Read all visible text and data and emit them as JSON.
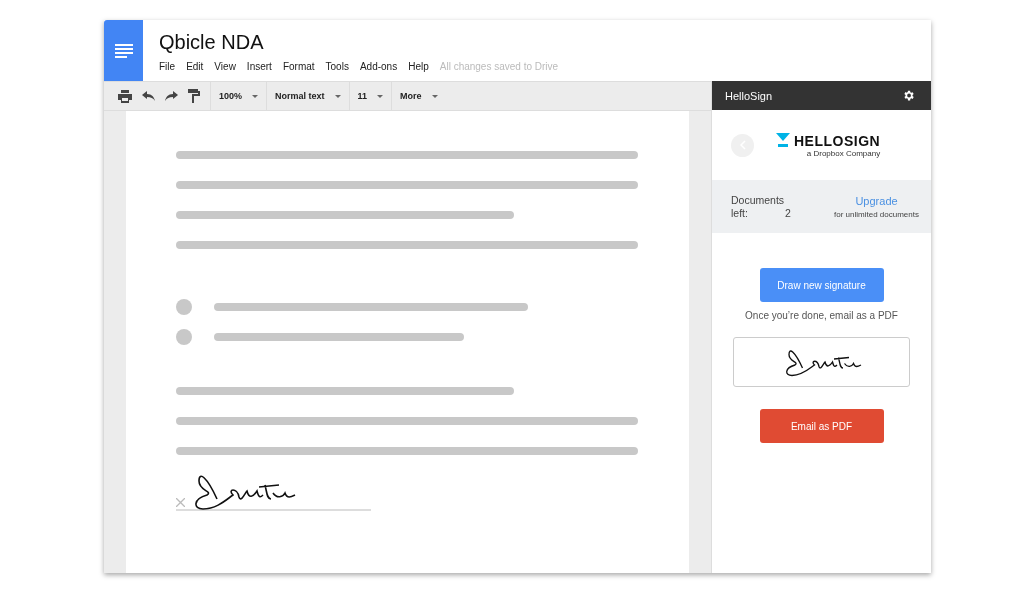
{
  "document": {
    "title": "Qbicle NDA",
    "menu": [
      "File",
      "Edit",
      "View",
      "Insert",
      "Format",
      "Tools",
      "Add-ons",
      "Help"
    ],
    "save_status": "All changes saved to Drive"
  },
  "toolbar": {
    "zoom": "100%",
    "style": "Normal text",
    "size": "11",
    "more": "More"
  },
  "page": {
    "blocks": [
      {
        "kind": "full"
      },
      {
        "kind": "full"
      },
      {
        "kind": "short"
      },
      {
        "kind": "full"
      },
      {
        "kind": "gap"
      },
      {
        "kind": "bullet-long"
      },
      {
        "kind": "bullet-short"
      },
      {
        "kind": "gap"
      },
      {
        "kind": "short"
      },
      {
        "kind": "full"
      },
      {
        "kind": "full"
      }
    ]
  },
  "sidebar": {
    "title": "HelloSign",
    "brand": "HELLOSIGN",
    "brand_sub": "a Dropbox Company",
    "documents_label": "Documents left:",
    "documents_count": "2",
    "upgrade": "Upgrade",
    "upgrade_note": "for unlimited documents",
    "draw_button": "Draw new signature",
    "hint": "Once you’re done, email as a PDF",
    "email_button": "Email as PDF"
  }
}
